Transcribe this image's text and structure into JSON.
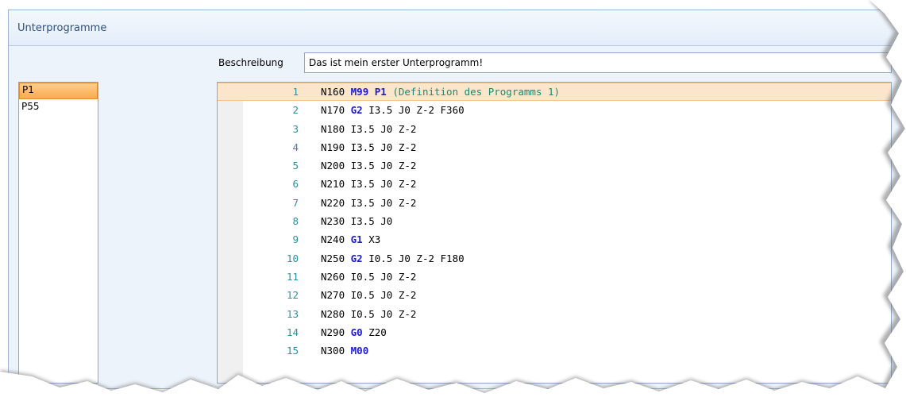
{
  "panel": {
    "title": "Unterprogramme"
  },
  "description": {
    "label": "Beschreibung",
    "value": "Das ist mein erster Unterprogramm!"
  },
  "programs": [
    {
      "label": "P1",
      "selected": true
    },
    {
      "label": "P55",
      "selected": false
    }
  ],
  "editor": {
    "lines": [
      {
        "num": "1",
        "segments": [
          {
            "t": "N160 ",
            "k": "n"
          },
          {
            "t": "M99 P1",
            "k": "kw"
          },
          {
            "t": " (Definition des Programms 1)",
            "k": "cm"
          }
        ]
      },
      {
        "num": "2",
        "segments": [
          {
            "t": "N170 ",
            "k": "n"
          },
          {
            "t": "G2",
            "k": "kw"
          },
          {
            "t": " I3.5 J0 Z-2 F360",
            "k": "n"
          }
        ]
      },
      {
        "num": "3",
        "segments": [
          {
            "t": "N180 I3.5 J0 Z-2",
            "k": "n"
          }
        ]
      },
      {
        "num": "4",
        "segments": [
          {
            "t": "N190 I3.5 J0 Z-2",
            "k": "n"
          }
        ]
      },
      {
        "num": "5",
        "segments": [
          {
            "t": "N200 I3.5 J0 Z-2",
            "k": "n"
          }
        ]
      },
      {
        "num": "6",
        "segments": [
          {
            "t": "N210 I3.5 J0 Z-2",
            "k": "n"
          }
        ]
      },
      {
        "num": "7",
        "segments": [
          {
            "t": "N220 I3.5 J0 Z-2",
            "k": "n"
          }
        ]
      },
      {
        "num": "8",
        "segments": [
          {
            "t": "N230 I3.5 J0",
            "k": "n"
          }
        ]
      },
      {
        "num": "9",
        "segments": [
          {
            "t": "N240 ",
            "k": "n"
          },
          {
            "t": "G1",
            "k": "kw"
          },
          {
            "t": " X3",
            "k": "n"
          }
        ]
      },
      {
        "num": "10",
        "segments": [
          {
            "t": "N250 ",
            "k": "n"
          },
          {
            "t": "G2",
            "k": "kw"
          },
          {
            "t": " I0.5 J0 Z-2 F180",
            "k": "n"
          }
        ]
      },
      {
        "num": "11",
        "segments": [
          {
            "t": "N260 I0.5 J0 Z-2",
            "k": "n"
          }
        ]
      },
      {
        "num": "12",
        "segments": [
          {
            "t": "N270 I0.5 J0 Z-2",
            "k": "n"
          }
        ]
      },
      {
        "num": "13",
        "segments": [
          {
            "t": "N280 I0.5 J0 Z-2",
            "k": "n"
          }
        ]
      },
      {
        "num": "14",
        "segments": [
          {
            "t": "N290 ",
            "k": "n"
          },
          {
            "t": "G0",
            "k": "kw"
          },
          {
            "t": " Z20",
            "k": "n"
          }
        ]
      },
      {
        "num": "15",
        "segments": [
          {
            "t": "N300 ",
            "k": "n"
          },
          {
            "t": "M00",
            "k": "kw"
          }
        ]
      }
    ]
  },
  "colors": {
    "keyword": "#1b1bd6",
    "comment": "#12906f",
    "line_number": "#2b8fa3",
    "selection": "#fba94f",
    "current_line": "#fbe6cc",
    "panel_border": "#9ab4d6"
  }
}
